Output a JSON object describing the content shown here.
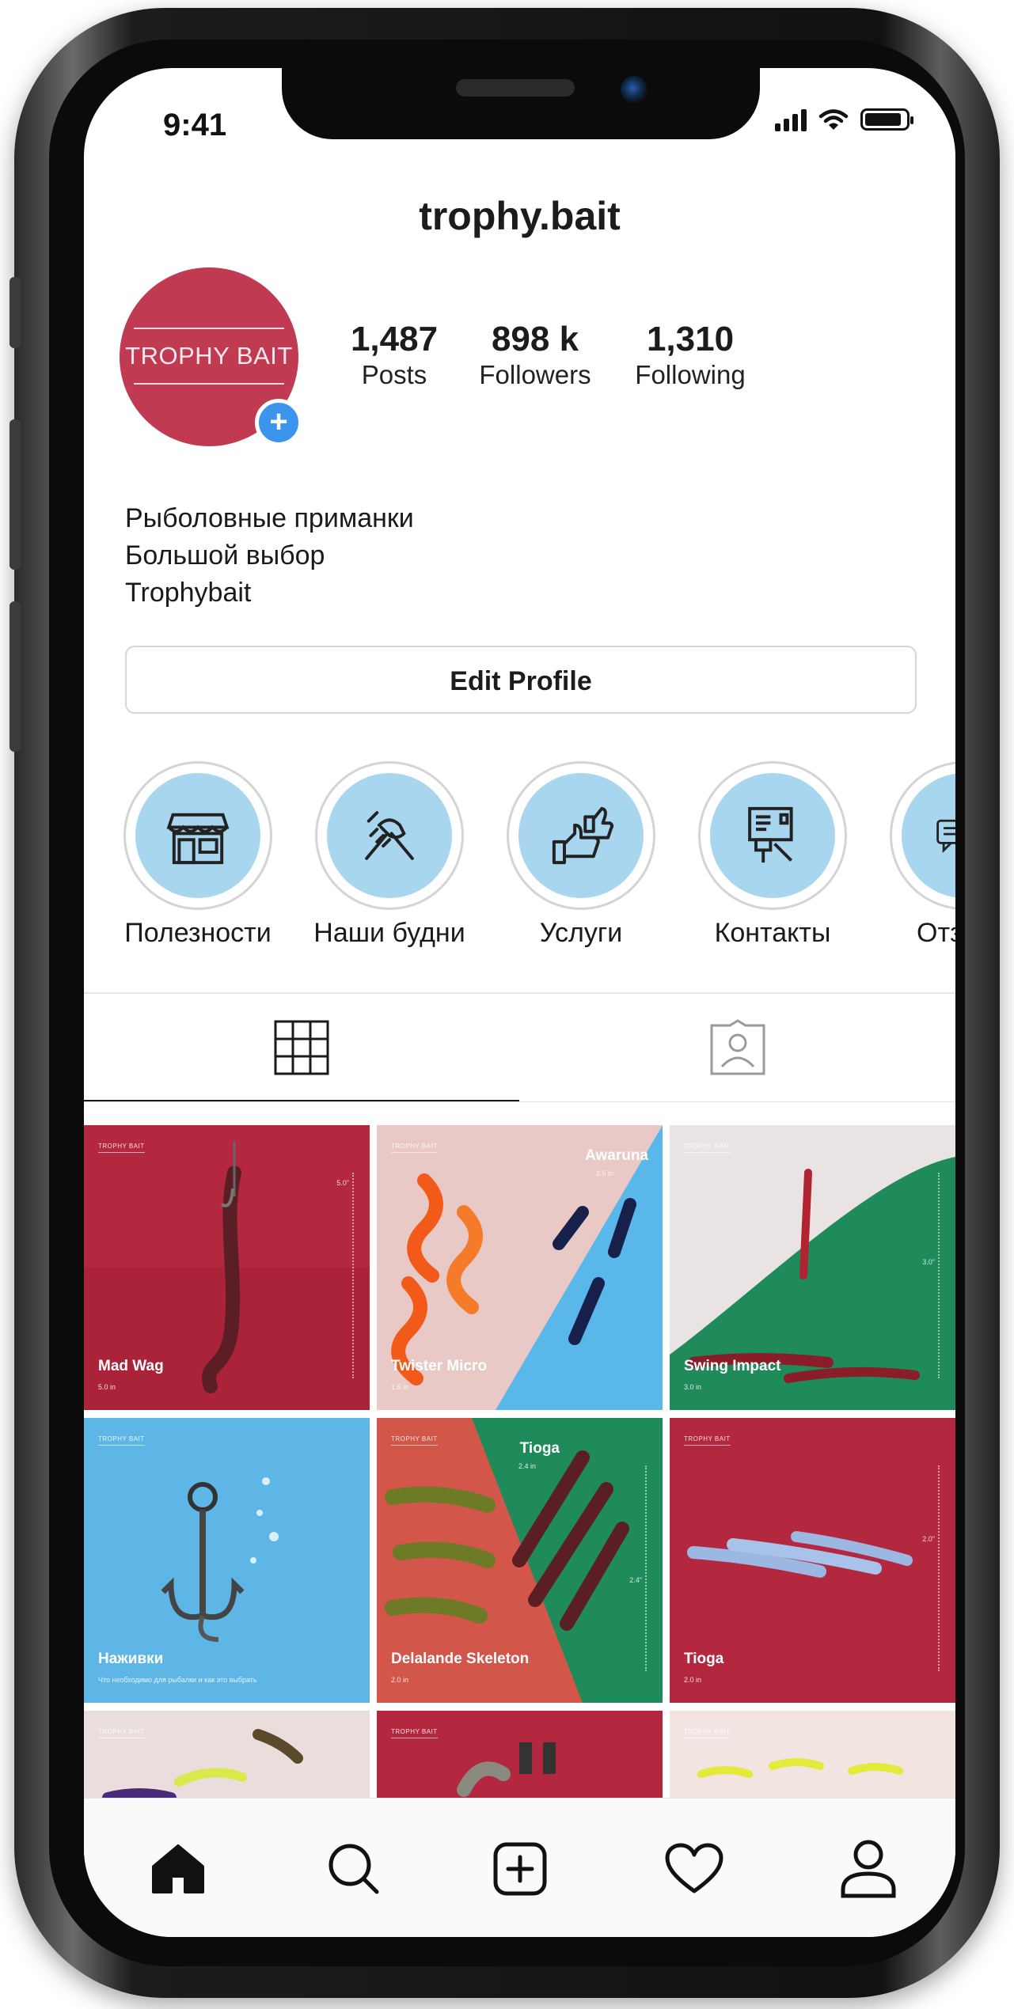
{
  "status_bar": {
    "time": "9:41"
  },
  "profile": {
    "username": "trophy.bait",
    "avatar_text": "TROPHY BAIT",
    "stats": [
      {
        "value": "1,487",
        "label": "Posts"
      },
      {
        "value": "898 k",
        "label": "Followers"
      },
      {
        "value": "1,310",
        "label": "Following"
      }
    ],
    "bio": [
      "Рыболовные приманки",
      "Большой выбор",
      "Trophybait"
    ],
    "edit_button": "Edit Profile"
  },
  "highlights": [
    {
      "label": "Полезности",
      "icon": "storefront-icon"
    },
    {
      "label": "Наши будни",
      "icon": "handshake-icon"
    },
    {
      "label": "Услуги",
      "icon": "thumbs-up-icon"
    },
    {
      "label": "Контакты",
      "icon": "contact-card-icon"
    },
    {
      "label": "Отзы",
      "icon": "chat-icon"
    }
  ],
  "tabs": [
    {
      "name": "grid-tab",
      "icon": "grid-icon",
      "active": true
    },
    {
      "name": "tagged-tab",
      "icon": "tagged-person-icon",
      "active": false
    }
  ],
  "posts": [
    {
      "brand": "TROPHY BAIT",
      "title": "Mad Wag",
      "sub": "5.0 in",
      "bg": "#b3283f",
      "ruler": "5.0\""
    },
    {
      "brand": "TROPHY BAIT",
      "title": "Twister Micro",
      "sub": "1.6 in",
      "corner": "Awaruna",
      "corner_sub": "2.5 in",
      "bg": "#e9c9c6",
      "accent": "#5ab7ea"
    },
    {
      "brand": "TROPHY BAIT",
      "title": "Swing Impact",
      "sub": "3.0 in",
      "bg": "#1f8a5a",
      "ruler": "3.0\""
    },
    {
      "brand": "TROPHY BAIT",
      "title": "Наживки",
      "sub": "Что необходимо для рыбалки и как это выбрать",
      "bg": "#5eb6e6"
    },
    {
      "brand": "TROPHY BAIT",
      "title": "Delalande Skeleton",
      "sub": "2.0 in",
      "corner": "Tioga",
      "corner_sub": "2.4 in",
      "bg": "#d3564b",
      "accent": "#1f8a5a",
      "ruler": "2.4\""
    },
    {
      "brand": "TROPHY BAIT",
      "title": "Tioga",
      "sub": "2.0 in",
      "bg": "#b3283f",
      "ruler": "2.0\""
    },
    {
      "brand": "TROPHY BAIT",
      "bg": "#eadedc"
    },
    {
      "brand": "TROPHY BAIT",
      "bg": "#b3283f"
    },
    {
      "brand": "TROPHY BAIT",
      "bg": "#f1e4e1"
    }
  ],
  "bottom_nav": [
    "home-icon",
    "search-icon",
    "new-post-icon",
    "activity-heart-icon",
    "profile-icon"
  ]
}
